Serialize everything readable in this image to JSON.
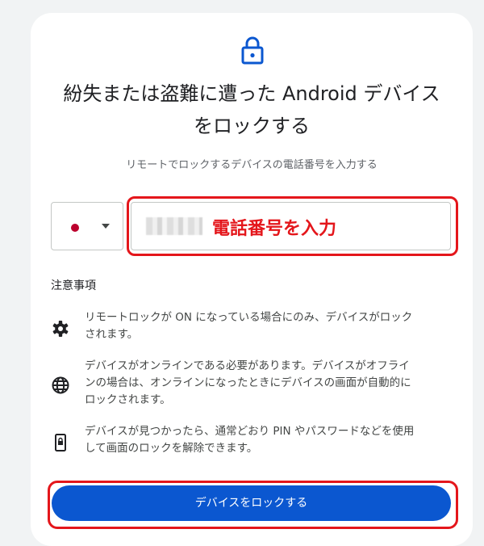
{
  "header": {
    "title_line1": "紛失または盗難に遭った Android デバイス",
    "title_line2": "をロックする",
    "subtitle": "リモートでロックするデバイスの電話番号を入力する"
  },
  "phone_form": {
    "country_flag": "jp-flag-icon",
    "phone_value_redacted": true,
    "annotation": "電話番号を入力"
  },
  "notes": {
    "title": "注意事項",
    "items": [
      {
        "icon": "gear-icon",
        "line1": "リモートロックが ON になっている場合にのみ、デバイスがロック",
        "line2": "されます。"
      },
      {
        "icon": "globe-icon",
        "line1": "デバイスがオンラインである必要があります。デバイスがオフライ",
        "line2": "ンの場合は、オンラインになったときにデバイスの画面が自動的に",
        "line3": "ロックされます。"
      },
      {
        "icon": "phone-lock-icon",
        "line1": "デバイスが見つかったら、通常どおり PIN やパスワードなどを使用",
        "line2": "して画面のロックを解除できます。"
      }
    ]
  },
  "actions": {
    "lock_button": "デバイスをロックする"
  },
  "colors": {
    "accent": "#0b57d0",
    "highlight": "#e4161b",
    "flag_red": "#bc002d"
  }
}
